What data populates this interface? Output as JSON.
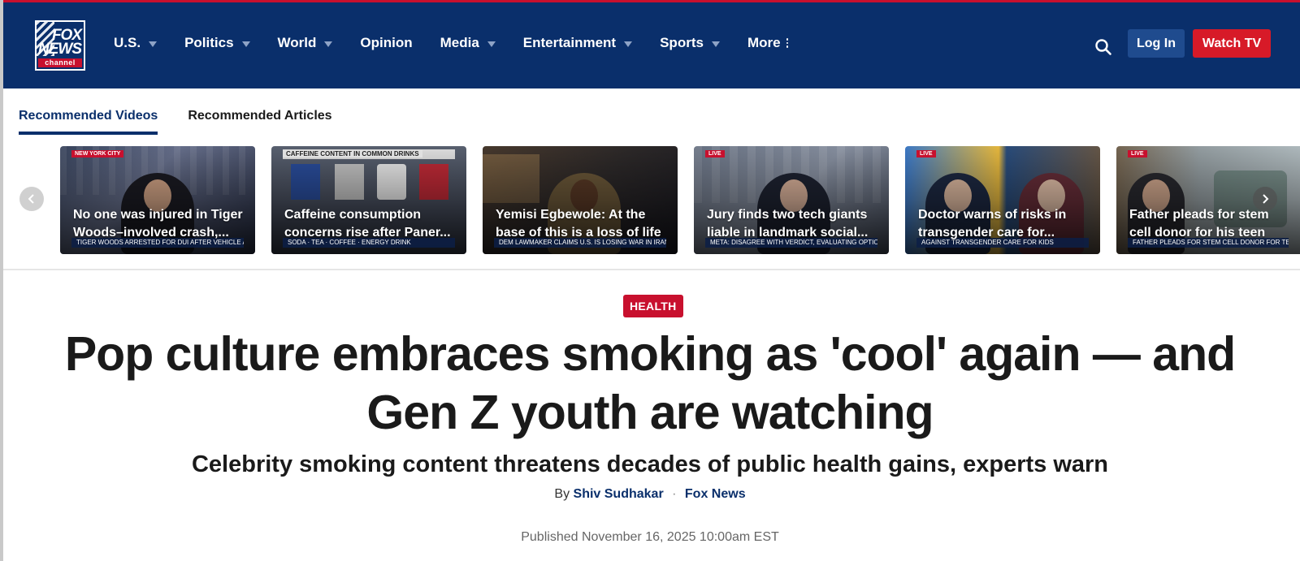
{
  "header": {
    "logo": {
      "line1": "FOX",
      "line2": "NEWS",
      "line3": "channel"
    },
    "nav": [
      {
        "label": "U.S.",
        "dropdown": true
      },
      {
        "label": "Politics",
        "dropdown": true
      },
      {
        "label": "World",
        "dropdown": true
      },
      {
        "label": "Opinion",
        "dropdown": false
      },
      {
        "label": "Media",
        "dropdown": true
      },
      {
        "label": "Entertainment",
        "dropdown": true
      },
      {
        "label": "Sports",
        "dropdown": true
      },
      {
        "label": "More",
        "dropdown": false
      }
    ],
    "login_label": "Log In",
    "watch_label": "Watch TV",
    "colors": {
      "header_bg": "#0a2f6b",
      "login_bg": "#1f4b8e",
      "watch_bg": "#d71a28"
    }
  },
  "recommended": {
    "tabs": [
      {
        "label": "Recommended Videos",
        "active": true
      },
      {
        "label": "Recommended Articles",
        "active": false
      }
    ],
    "videos": [
      {
        "caption": "No one was injured in Tiger Woods–involved crash,...",
        "badge": "NEW YORK CITY",
        "lower_third": "TIGER WOODS ARRESTED FOR DUI AFTER VEHICLE ACCIDENT"
      },
      {
        "caption": "Caffeine consumption concerns rise after Paner...",
        "badge": "CAFFEINE CONTENT IN COMMON DRINKS",
        "lower_third": "SODA · TEA · COFFEE · ENERGY DRINK"
      },
      {
        "caption": "Yemisi Egbewole: At the base of this is a loss of life",
        "badge": "",
        "lower_third": "DEM LAWMAKER CLAIMS U.S. IS LOSING WAR IN IRAN"
      },
      {
        "caption": "Jury finds two tech giants liable in landmark social...",
        "badge": "LIVE",
        "lower_third": "META: DISAGREE WITH VERDICT, EVALUATING OPTIONS"
      },
      {
        "caption": "Doctor warns of risks in transgender care for...",
        "badge": "LIVE",
        "lower_third": "AGAINST TRANSGENDER CARE FOR KIDS"
      },
      {
        "caption": "Father pleads for stem cell donor for his teen son",
        "badge": "LIVE",
        "lower_third": "FATHER PLEADS FOR STEM CELL DONOR FOR TEEN SON"
      }
    ]
  },
  "article": {
    "category": "HEALTH",
    "headline": "Pop culture embraces smoking as 'cool' again — and Gen Z youth are watching",
    "subheadline": "Celebrity smoking content threatens decades of public health gains, experts warn",
    "by_prefix": "By",
    "author": "Shiv Sudhakar",
    "source": "Fox News",
    "published": "Published November 16, 2025 10:00am EST",
    "colors": {
      "category_bg": "#c8102e",
      "link": "#0a2f6b"
    }
  }
}
